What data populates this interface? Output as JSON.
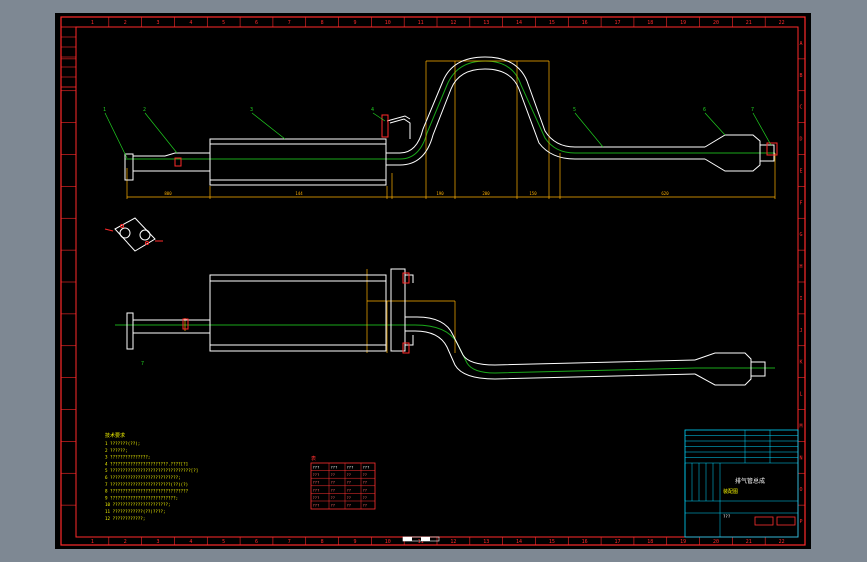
{
  "drawing": {
    "colors": {
      "background": "#000000",
      "frame": "#ff2a2a",
      "outline": "#ffffff",
      "centerline": "#1aa81a",
      "dimension": "#ffb000",
      "leader": "#20d020",
      "notes": "#f2f200",
      "table_border": "#ff3030",
      "title_block": "#00d8ff",
      "viewport_bg": "#7e8893"
    },
    "column_numbers": [
      "1",
      "2",
      "3",
      "4",
      "5",
      "6",
      "7",
      "8",
      "9",
      "10",
      "11",
      "12",
      "13",
      "14",
      "15",
      "16",
      "17",
      "18",
      "19",
      "20",
      "21",
      "22"
    ],
    "row_letters": [
      "A",
      "B",
      "C",
      "D",
      "E",
      "F",
      "G",
      "H",
      "I",
      "J",
      "K",
      "L",
      "M",
      "N",
      "O",
      "P"
    ],
    "part_callouts": [
      "1",
      "2",
      "3",
      "4",
      "5",
      "6",
      "7"
    ],
    "dimensions_top": [
      "800",
      "144",
      "190",
      "200",
      "150",
      "620"
    ],
    "notes_title": "技术要求",
    "notes": [
      "1  ???????(??);",
      "2  ??????;",
      "3  ???????????????;",
      "4  ???????????????????????.????[?]",
      "5  ????????????????????????????????[?]",
      "6  ???????????????????????????;",
      "7  ????????????????????????(??)(?)",
      "8  ???????????????????????????????",
      "9  ??????????????????????????;",
      "10 ??????????????????????;",
      "11 ????????????(??)????;",
      "12 ????????????;"
    ],
    "table": {
      "title": "表",
      "header": [
        "???",
        "???",
        "???",
        "???"
      ],
      "rows": [
        [
          "???",
          "??",
          "??",
          "??"
        ],
        [
          "???",
          "??",
          "??",
          "??"
        ],
        [
          "???",
          "??",
          "??",
          "??"
        ],
        [
          "???",
          "??",
          "??",
          "??"
        ],
        [
          "???",
          "??",
          "??",
          "??"
        ]
      ]
    },
    "title_block": {
      "title": "排气管总成",
      "drawing_name": "装配图",
      "label_small": "???"
    }
  }
}
